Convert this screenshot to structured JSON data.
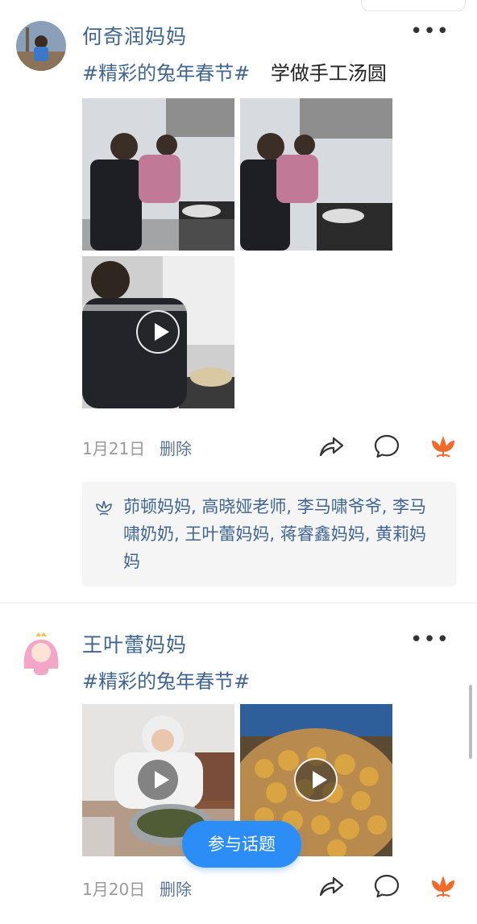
{
  "posts": [
    {
      "author": "何奇润妈妈",
      "topic": "#精彩的兔年春节#",
      "caption": "学做手工汤圆",
      "date": "1月21日",
      "delete_label": "删除",
      "likes": "茆顿妈妈, 高晓娅老师, 李马啸爷爷, 李马啸奶奶, 王叶蕾妈妈, 蒋睿鑫妈妈, 黄莉妈妈",
      "media": [
        {
          "kind": "photo"
        },
        {
          "kind": "photo"
        },
        {
          "kind": "video"
        }
      ]
    },
    {
      "author": "王叶蕾妈妈",
      "topic": "#精彩的兔年春节#",
      "caption": "",
      "date": "1月20日",
      "delete_label": "删除",
      "media": [
        {
          "kind": "video"
        },
        {
          "kind": "video"
        }
      ]
    }
  ],
  "more_icon": "more-dots-icon",
  "actions": [
    "share-icon",
    "comment-icon",
    "like-flower-icon"
  ],
  "fab_label": "参与话题",
  "colors": {
    "link": "#3f6590",
    "accent": "#2c8df6",
    "like": "#f06a2b"
  }
}
